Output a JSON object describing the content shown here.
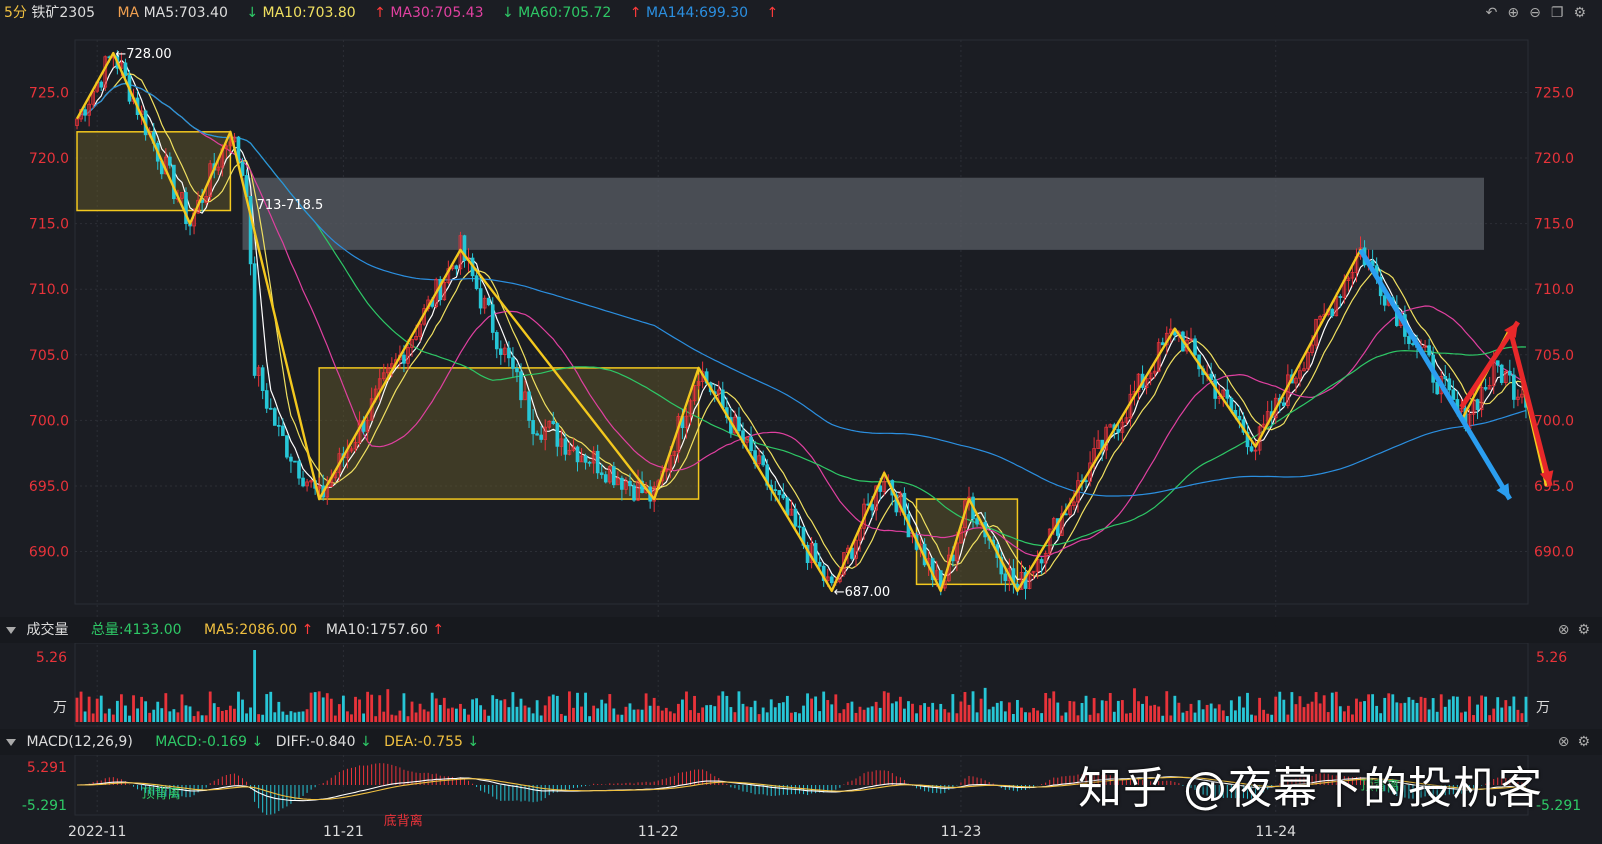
{
  "header": {
    "period": "5分",
    "symbol": "铁矿2305",
    "ma_label": "MA",
    "ma5": "MA5:703.40",
    "ma10": "MA10:703.80",
    "ma30": "MA30:705.43",
    "ma60": "MA60:705.72",
    "ma144": "MA144:699.30",
    "ma10_dir": "↓",
    "ma30_dir": "↑",
    "ma60_dir": "↓",
    "ma144_dir": "↑",
    "end_dir": "↑"
  },
  "toolbar_icons": [
    "undo-icon",
    "zoom-in-icon",
    "zoom-out-icon",
    "window-icon",
    "settings-icon"
  ],
  "volume_panel": {
    "title": "成交量",
    "total": "总量:4133.00",
    "ma5": "MA5:2086.00",
    "ma10": "MA10:1757.60",
    "ma5_dir": "↑",
    "ma10_dir": "↑",
    "axis_top": "5.26",
    "axis_unit": "万"
  },
  "macd_panel": {
    "title": "MACD(12,26,9)",
    "macd": "MACD:-0.169",
    "diff": "DIFF:-0.840",
    "dea": "DEA:-0.755",
    "macd_dir": "↓",
    "diff_dir": "↓",
    "dea_dir": "↓",
    "axis_top": "5.291",
    "axis_bottom": "-5.291",
    "annotations": [
      "顶背离",
      "底背离",
      "顶背离"
    ]
  },
  "watermark": "知乎 @夜幕下的投机客",
  "colors": {
    "bg": "#1b1d23",
    "up": "#e8333a",
    "down": "#27c6d6",
    "ma5": "#ffffff",
    "ma10": "#f0e060",
    "ma30": "#e040a0",
    "ma60": "#2ec866",
    "ma144": "#2b8fe0",
    "zigzag": "#f3c81e",
    "grid": "#2c2f36"
  },
  "chart_data": {
    "type": "candlestick",
    "title": "铁矿2305 5分",
    "y_axis_ticks": [
      "725.0",
      "720.0",
      "715.0",
      "710.0",
      "705.0",
      "700.0",
      "695.0",
      "690.0"
    ],
    "ylim": [
      686,
      729
    ],
    "x_tick_labels": [
      "2022-11",
      "11-21",
      "11-22",
      "11-23",
      "11-24"
    ],
    "annotations": [
      "←728.00",
      "713-718.5",
      "←687.00"
    ],
    "price_path_approx": [
      {
        "idx": 0,
        "price": 723
      },
      {
        "idx": 9,
        "price": 728
      },
      {
        "idx": 28,
        "price": 715
      },
      {
        "idx": 38,
        "price": 722
      },
      {
        "idx": 42,
        "price": 718
      },
      {
        "idx": 44,
        "price": 704
      },
      {
        "idx": 50,
        "price": 699
      },
      {
        "idx": 60,
        "price": 694
      },
      {
        "idx": 95,
        "price": 713
      },
      {
        "idx": 113,
        "price": 700
      },
      {
        "idx": 143,
        "price": 694
      },
      {
        "idx": 154,
        "price": 704
      },
      {
        "idx": 187,
        "price": 687
      },
      {
        "idx": 200,
        "price": 696
      },
      {
        "idx": 214,
        "price": 687
      },
      {
        "idx": 221,
        "price": 694
      },
      {
        "idx": 233,
        "price": 687
      },
      {
        "idx": 252,
        "price": 697
      },
      {
        "idx": 272,
        "price": 707
      },
      {
        "idx": 292,
        "price": 698
      },
      {
        "idx": 318,
        "price": 713
      },
      {
        "idx": 343,
        "price": 700
      },
      {
        "idx": 352,
        "price": 704
      },
      {
        "idx": 358,
        "price": 702
      }
    ],
    "zigzag_prices": [
      723,
      728,
      715,
      722,
      694,
      713,
      694,
      704,
      687,
      696,
      687,
      694,
      687,
      707,
      698,
      713,
      700,
      707,
      695
    ],
    "rectangles": [
      {
        "label": "consolidation-1",
        "y_range": [
          716,
          722
        ]
      },
      {
        "label": "consolidation-2",
        "y_range": [
          694,
          704
        ]
      },
      {
        "label": "consolidation-3",
        "y_range": [
          687.5,
          694
        ]
      }
    ],
    "resistance_zone": [
      713,
      718.5
    ],
    "projections": [
      {
        "name": "blue-arrow",
        "from": 713,
        "to": 694
      },
      {
        "name": "red-arrow-up",
        "from": 701,
        "to": 707.5
      },
      {
        "name": "red-arrow-down",
        "from": 707,
        "to": 695
      }
    ],
    "ma_series": [
      {
        "name": "MA5",
        "color": "#ffffff"
      },
      {
        "name": "MA10",
        "color": "#f0e060"
      },
      {
        "name": "MA30",
        "color": "#e040a0"
      },
      {
        "name": "MA60",
        "color": "#2ec866"
      },
      {
        "name": "MA144",
        "color": "#2b8fe0"
      }
    ]
  }
}
